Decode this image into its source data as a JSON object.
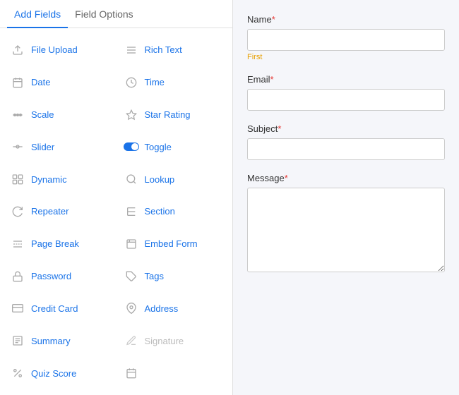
{
  "tabs": [
    {
      "id": "add-fields",
      "label": "Add Fields",
      "active": true
    },
    {
      "id": "field-options",
      "label": "Field Options",
      "active": false
    }
  ],
  "fields": [
    {
      "id": "file-upload",
      "label": "File Upload",
      "icon": "upload",
      "disabled": false,
      "col": 0
    },
    {
      "id": "rich-text",
      "label": "Rich Text",
      "icon": "lines",
      "disabled": false,
      "col": 1
    },
    {
      "id": "date",
      "label": "Date",
      "icon": "calendar",
      "disabled": false,
      "col": 0
    },
    {
      "id": "time",
      "label": "Time",
      "icon": "clock",
      "disabled": false,
      "col": 1
    },
    {
      "id": "scale",
      "label": "Scale",
      "icon": "scale",
      "disabled": false,
      "col": 0
    },
    {
      "id": "star-rating",
      "label": "Star Rating",
      "icon": "star",
      "disabled": false,
      "col": 1
    },
    {
      "id": "slider",
      "label": "Slider",
      "icon": "slider",
      "disabled": false,
      "col": 0
    },
    {
      "id": "toggle",
      "label": "Toggle",
      "icon": "toggle",
      "disabled": false,
      "col": 1
    },
    {
      "id": "dynamic",
      "label": "Dynamic",
      "icon": "dynamic",
      "disabled": false,
      "col": 0
    },
    {
      "id": "lookup",
      "label": "Lookup",
      "icon": "search",
      "disabled": false,
      "col": 1
    },
    {
      "id": "repeater",
      "label": "Repeater",
      "icon": "repeater",
      "disabled": false,
      "col": 0
    },
    {
      "id": "section",
      "label": "Section",
      "icon": "heading",
      "disabled": false,
      "col": 1
    },
    {
      "id": "page-break",
      "label": "Page Break",
      "icon": "page-break",
      "disabled": false,
      "col": 0
    },
    {
      "id": "embed-form",
      "label": "Embed Form",
      "icon": "embed",
      "disabled": false,
      "col": 1
    },
    {
      "id": "password",
      "label": "Password",
      "icon": "lock",
      "disabled": false,
      "col": 0
    },
    {
      "id": "tags",
      "label": "Tags",
      "icon": "tag",
      "disabled": false,
      "col": 1
    },
    {
      "id": "credit-card",
      "label": "Credit Card",
      "icon": "credit-card",
      "disabled": false,
      "col": 0
    },
    {
      "id": "address",
      "label": "Address",
      "icon": "location",
      "disabled": false,
      "col": 1
    },
    {
      "id": "summary",
      "label": "Summary",
      "icon": "summary",
      "disabled": false,
      "col": 0
    },
    {
      "id": "signature",
      "label": "Signature",
      "icon": "pen",
      "disabled": true,
      "col": 1
    },
    {
      "id": "quiz-score",
      "label": "Quiz Score",
      "icon": "percent",
      "disabled": false,
      "col": 0
    },
    {
      "id": "calendar2",
      "label": "",
      "icon": "calendar2",
      "disabled": false,
      "col": 1
    }
  ],
  "form": {
    "name_label": "Name",
    "name_required": "*",
    "name_hint": "First",
    "email_label": "Email",
    "email_required": "*",
    "subject_label": "Subject",
    "subject_required": "*",
    "message_label": "Message",
    "message_required": "*"
  }
}
